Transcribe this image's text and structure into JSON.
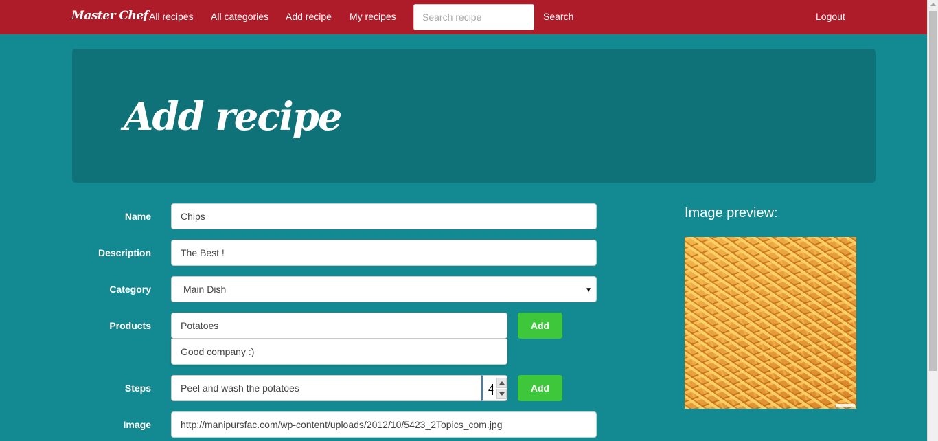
{
  "nav": {
    "brand": "Master Chef",
    "links": [
      "All recipes",
      "All categories",
      "Add recipe",
      "My recipes"
    ],
    "search_placeholder": "Search recipe",
    "search_label": "Search",
    "logout_label": "Logout"
  },
  "page_title": "Add recipe",
  "form": {
    "name_label": "Name",
    "name_value": "Chips",
    "description_label": "Description",
    "description_value": "The Best !",
    "category_label": "Category",
    "category_value": "Main Dish",
    "products_label": "Products",
    "products_value": "Potatoes",
    "products_suggestion": "Good company :)",
    "products_add_label": "Add",
    "steps_label": "Steps",
    "steps_value": "Peel and wash the potatoes",
    "steps_number": "4",
    "steps_add_label": "Add",
    "image_label": "Image",
    "image_value": "http://manipursfac.com/wp-content/uploads/2012/10/5423_2Topics_com.jpg"
  },
  "preview": {
    "title": "Image preview:"
  },
  "colors": {
    "navbar": "#af1c29",
    "background": "#138a91",
    "jumbotron": "#0f7279",
    "add_button": "#3ec73a"
  }
}
